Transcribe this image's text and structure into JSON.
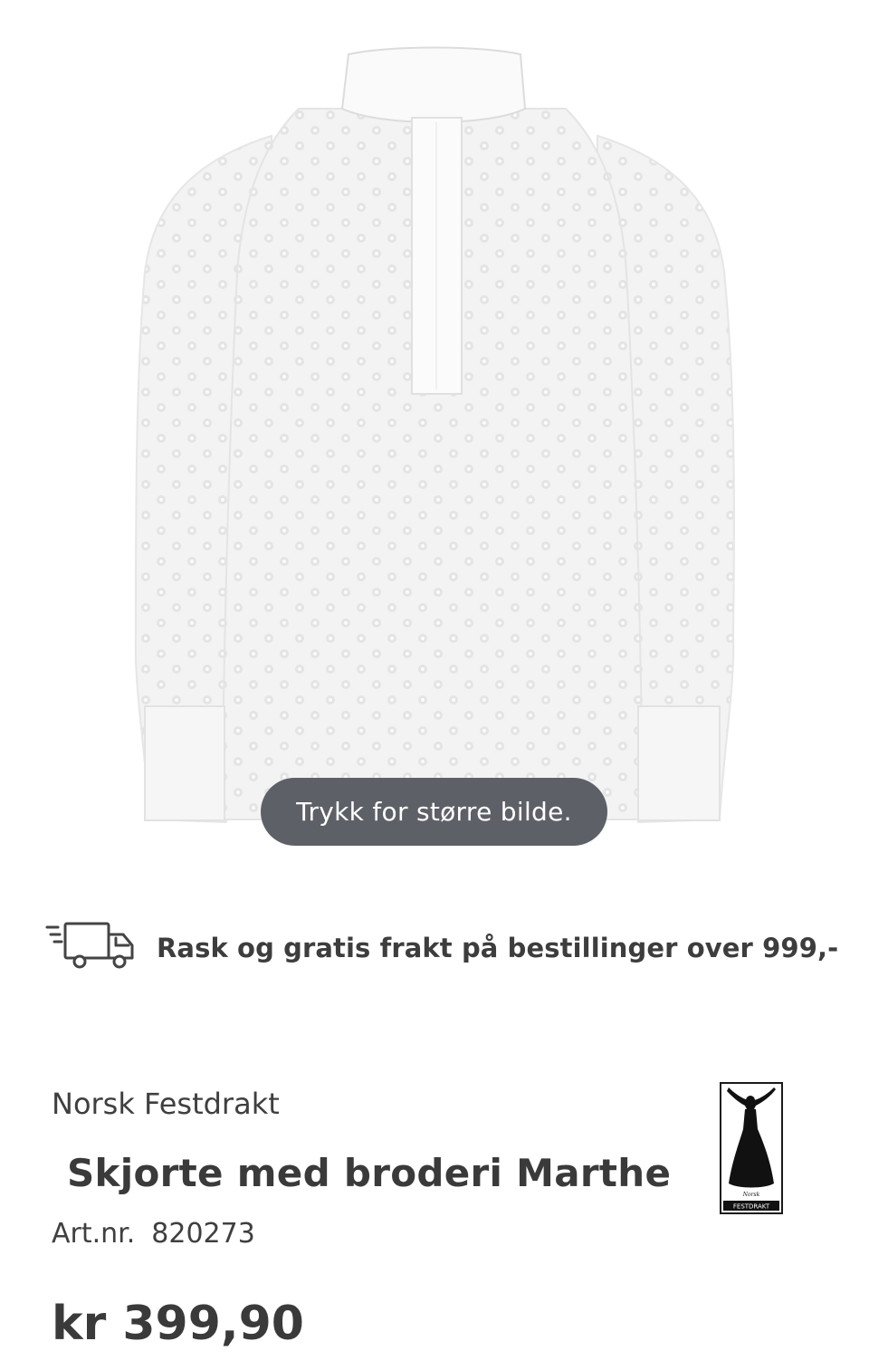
{
  "product": {
    "image_alt": "Skjorte med broderi Marthe",
    "zoom_hint": "Trykk for større bilde.",
    "brand": "Norsk Festdrakt",
    "title": "Skjorte med broderi Marthe",
    "article_label": "Art.nr.",
    "article_number": "820273",
    "price": "kr 399,90"
  },
  "shipping": {
    "icon": "delivery-truck-icon",
    "text": "Rask og gratis frakt på bestillinger over 999,-"
  },
  "brand_logo": {
    "top_text": "Norsk",
    "bottom_text": "FESTDRAKT"
  },
  "colors": {
    "hint_bg": "#5d6066",
    "text": "#3a3a3a"
  }
}
